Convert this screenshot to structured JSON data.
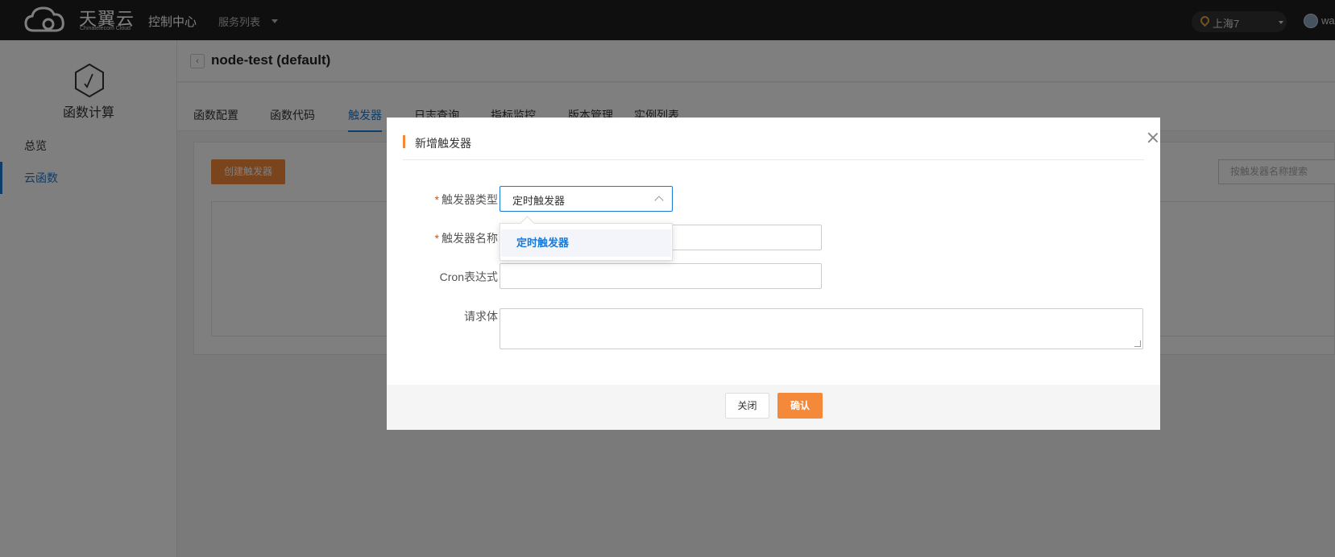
{
  "topbar": {
    "logo_text": "天翼云",
    "logo_sub": "Chinatelecom Cloud",
    "console": "控制中心",
    "service_list": "服务列表",
    "region": "上海7",
    "user": "wa"
  },
  "sidebar": {
    "title": "函数计算",
    "items": [
      {
        "label": "总览"
      },
      {
        "label": "云函数"
      }
    ]
  },
  "page": {
    "title": "node-test (default)",
    "tabs": [
      {
        "label": "函数配置"
      },
      {
        "label": "函数代码"
      },
      {
        "label": "触发器"
      },
      {
        "label": "日志查询"
      },
      {
        "label": "指标监控"
      },
      {
        "label": "版本管理"
      },
      {
        "label": "实例列表"
      }
    ],
    "active_tab": "触发器",
    "create_button": "创建触发器",
    "search_placeholder": "按触发器名称搜索"
  },
  "modal": {
    "title": "新增触发器",
    "fields": {
      "type_label": "触发器类型",
      "type_value": "定时触发器",
      "name_label": "触发器名称",
      "cron_label": "Cron表达式",
      "body_label": "请求体"
    },
    "dropdown_options": [
      {
        "label": "定时触发器",
        "selected": true
      }
    ],
    "close_button": "关闭",
    "confirm_button": "确认"
  },
  "colors": {
    "accent_orange": "#f5893a",
    "link_blue": "#1b7ad6",
    "topbar_bg": "#1f1f1f"
  }
}
